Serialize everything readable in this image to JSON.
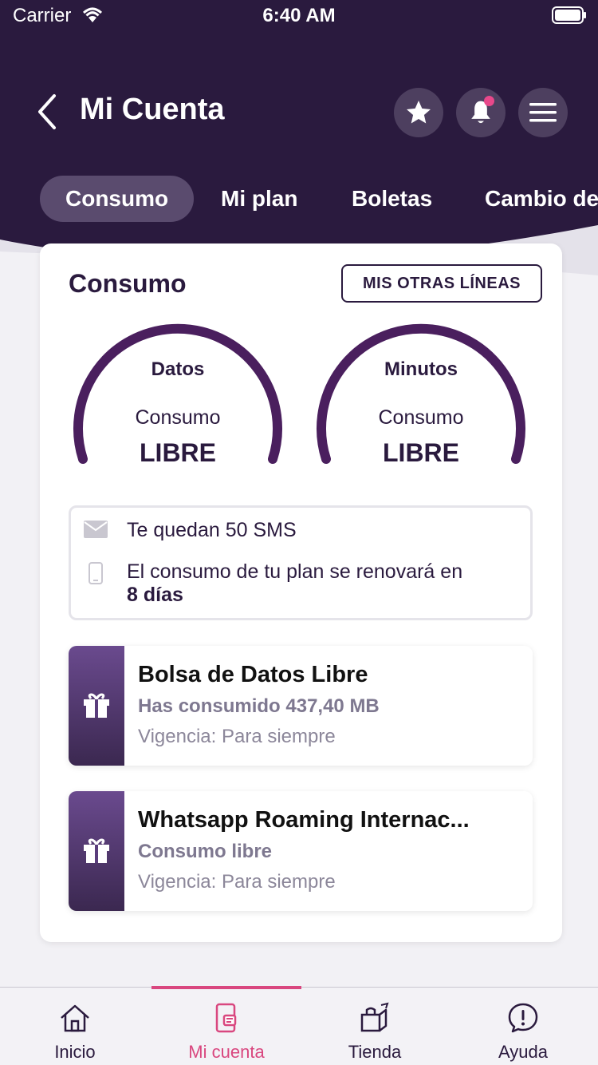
{
  "status_bar": {
    "carrier": "Carrier",
    "time": "6:40 AM"
  },
  "header": {
    "title": "Mi Cuenta"
  },
  "tabs": [
    {
      "label": "Consumo",
      "active": true
    },
    {
      "label": "Mi plan"
    },
    {
      "label": "Boletas"
    },
    {
      "label": "Cambio de"
    }
  ],
  "consumo": {
    "title": "Consumo",
    "other_lines_label": "MIS OTRAS LÍNEAS",
    "gauges": [
      {
        "title": "Datos",
        "subtitle": "Consumo",
        "value": "LIBRE"
      },
      {
        "title": "Minutos",
        "subtitle": "Consumo",
        "value": "LIBRE"
      }
    ],
    "info": {
      "sms": "Te quedan 50 SMS",
      "renew_text": "El consumo de tu plan se renovará en",
      "renew_days": "8 días"
    },
    "bonuses": [
      {
        "title": "Bolsa de Datos Libre",
        "subtitle": "Has consumido 437,40 MB",
        "validity": "Vigencia: Para siempre"
      },
      {
        "title": "Whatsapp Roaming Internac...",
        "subtitle": "Consumo libre",
        "validity": "Vigencia: Para siempre"
      }
    ]
  },
  "bottom_nav": [
    {
      "label": "Inicio",
      "icon": "home-icon"
    },
    {
      "label": "Mi cuenta",
      "icon": "phone-account-icon",
      "active": true
    },
    {
      "label": "Tienda",
      "icon": "store-icon"
    },
    {
      "label": "Ayuda",
      "icon": "help-icon"
    }
  ],
  "colors": {
    "primary": "#2a1a3e",
    "accent": "#d9477f",
    "gauge": "#4a1f5e"
  }
}
